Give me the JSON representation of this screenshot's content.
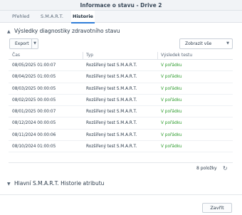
{
  "window": {
    "title": "Informace o stavu - Drive 2"
  },
  "tabs": [
    {
      "label": "Přehled"
    },
    {
      "label": "S.M.A.R.T."
    },
    {
      "label": "Historie"
    }
  ],
  "section1": {
    "title": "Výsledky diagnostiky zdravotního stavu"
  },
  "toolbar": {
    "export_label": "Export",
    "filter_value": "Zobrazit vše"
  },
  "table": {
    "columns": [
      "Čas",
      "Typ",
      "Výsledek testu"
    ],
    "rows": [
      {
        "time": "08/05/2025 01:00:07",
        "type": "Rozšířený test S.M.A.R.T.",
        "result": "V pořádku"
      },
      {
        "time": "08/04/2025 01:00:05",
        "type": "Rozšířený test S.M.A.R.T.",
        "result": "V pořádku"
      },
      {
        "time": "08/03/2025 00:00:05",
        "type": "Rozšířený test S.M.A.R.T.",
        "result": "V pořádku"
      },
      {
        "time": "08/02/2025 00:00:05",
        "type": "Rozšířený test S.M.A.R.T.",
        "result": "V pořádku"
      },
      {
        "time": "08/01/2025 00:00:07",
        "type": "Rozšířený test S.M.A.R.T.",
        "result": "V pořádku"
      },
      {
        "time": "08/12/2024 00:00:05",
        "type": "Rozšířený test S.M.A.R.T.",
        "result": "V pořádku"
      },
      {
        "time": "08/11/2024 00:00:06",
        "type": "Rozšířený test S.M.A.R.T.",
        "result": "V pořádku"
      },
      {
        "time": "08/10/2024 01:00:05",
        "type": "Rozšířený test S.M.A.R.T.",
        "result": "V pořádku"
      }
    ]
  },
  "pagination": {
    "count_label": "8 položky"
  },
  "section2": {
    "title": "Hlavní S.M.A.R.T. Historie atributu"
  },
  "footer": {
    "done_label": "Zavřít"
  },
  "icons": {
    "section_expanded": "chevron-up-icon",
    "section_collapsed": "chevron-down-icon",
    "refresh": "refresh-icon",
    "dropdown": "caret-down-icon"
  },
  "colors": {
    "accent": "#2f7ed8",
    "ok_text": "#2e9c2e"
  }
}
